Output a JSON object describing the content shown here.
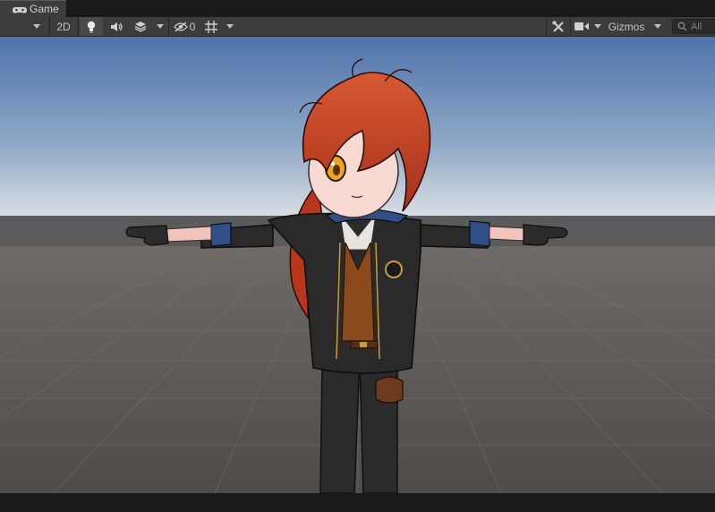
{
  "window": {
    "tab_label": "Game",
    "tab_icon": "gamepad-icon"
  },
  "toolbar": {
    "button_2d_label": "2D",
    "hidden_count": "0",
    "gizmos_label": "Gizmos",
    "search_placeholder": "All",
    "icons": [
      "dropdown-arrow-icon",
      "lightbulb-icon",
      "audio-icon",
      "effects-layers-icon",
      "visibility-icon",
      "grid-icon",
      "tools-icon",
      "camera-icon",
      "search-icon"
    ]
  },
  "scene": {
    "sky_top_color": "#5277ad",
    "sky_horizon_color": "#d7dde4",
    "ground_color": "#5a5552",
    "hair_color": "#c43d1f",
    "jacket_color": "#262626",
    "vest_color": "#8a4a1c",
    "cuff_color": "#2f4f86",
    "eye_color": "#e7a722"
  }
}
